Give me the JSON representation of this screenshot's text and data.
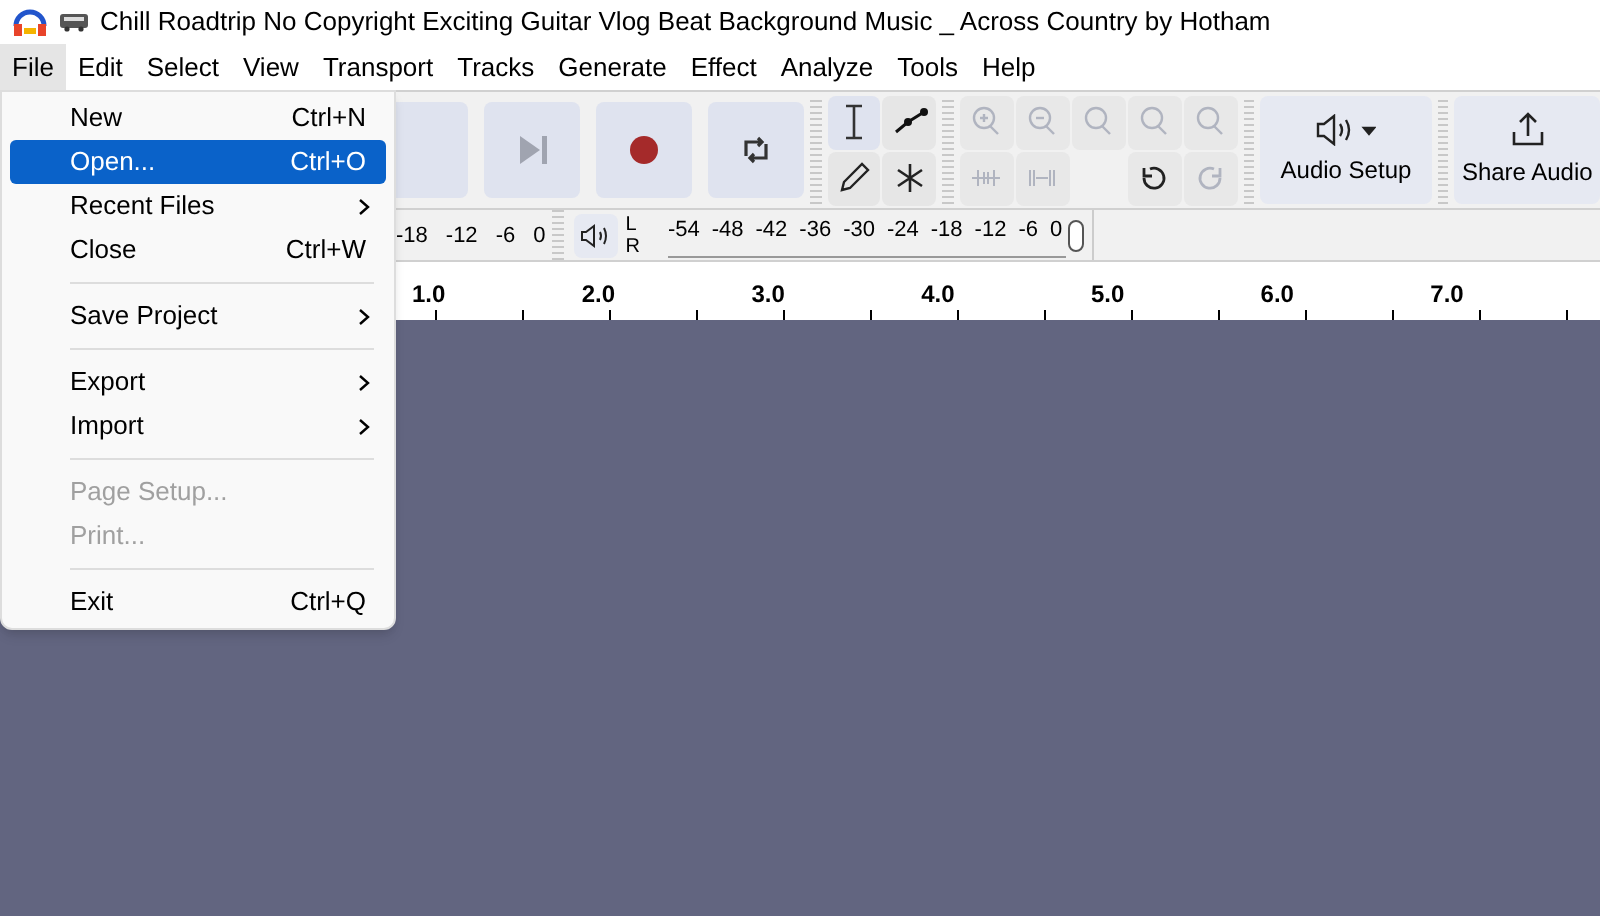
{
  "window": {
    "title": "Chill Roadtrip No Copyright Exciting Guitar Vlog Beat Background Music _ Across Country by Hotham"
  },
  "menubar": [
    {
      "label": "File",
      "selected": true
    },
    {
      "label": "Edit",
      "selected": false
    },
    {
      "label": "Select",
      "selected": false
    },
    {
      "label": "View",
      "selected": false
    },
    {
      "label": "Transport",
      "selected": false
    },
    {
      "label": "Tracks",
      "selected": false
    },
    {
      "label": "Generate",
      "selected": false
    },
    {
      "label": "Effect",
      "selected": false
    },
    {
      "label": "Analyze",
      "selected": false
    },
    {
      "label": "Tools",
      "selected": false
    },
    {
      "label": "Help",
      "selected": false
    }
  ],
  "file_menu": [
    {
      "kind": "item",
      "label": "New",
      "shortcut": "Ctrl+N",
      "submenu": false,
      "disabled": false,
      "selected": false
    },
    {
      "kind": "item",
      "label": "Open...",
      "shortcut": "Ctrl+O",
      "submenu": false,
      "disabled": false,
      "selected": true
    },
    {
      "kind": "item",
      "label": "Recent Files",
      "submenu": true,
      "disabled": false,
      "selected": false
    },
    {
      "kind": "item",
      "label": "Close",
      "shortcut": "Ctrl+W",
      "submenu": false,
      "disabled": false,
      "selected": false
    },
    {
      "kind": "separator"
    },
    {
      "kind": "item",
      "label": "Save Project",
      "submenu": true,
      "disabled": false,
      "selected": false
    },
    {
      "kind": "separator"
    },
    {
      "kind": "item",
      "label": "Export",
      "submenu": true,
      "disabled": false,
      "selected": false
    },
    {
      "kind": "item",
      "label": "Import",
      "submenu": true,
      "disabled": false,
      "selected": false
    },
    {
      "kind": "separator"
    },
    {
      "kind": "item",
      "label": "Page Setup...",
      "submenu": false,
      "disabled": true,
      "selected": false
    },
    {
      "kind": "item",
      "label": "Print...",
      "submenu": false,
      "disabled": true,
      "selected": false
    },
    {
      "kind": "separator"
    },
    {
      "kind": "item",
      "label": "Exit",
      "shortcut": "Ctrl+Q",
      "submenu": false,
      "disabled": false,
      "selected": false
    }
  ],
  "toolbar": {
    "audio_setup": "Audio Setup",
    "share_audio": "Share Audio"
  },
  "record_meter": {
    "ticks": [
      "-18",
      "-12",
      "-6",
      "0"
    ]
  },
  "playback_meter": {
    "channels": [
      "L",
      "R"
    ],
    "ticks": [
      "-54",
      "-48",
      "-42",
      "-36",
      "-30",
      "-24",
      "-18",
      "-12",
      "-6",
      "0"
    ]
  },
  "ruler": {
    "labels": [
      "1.0",
      "2.0",
      "3.0",
      "4.0",
      "5.0",
      "6.0",
      "7.0"
    ]
  }
}
